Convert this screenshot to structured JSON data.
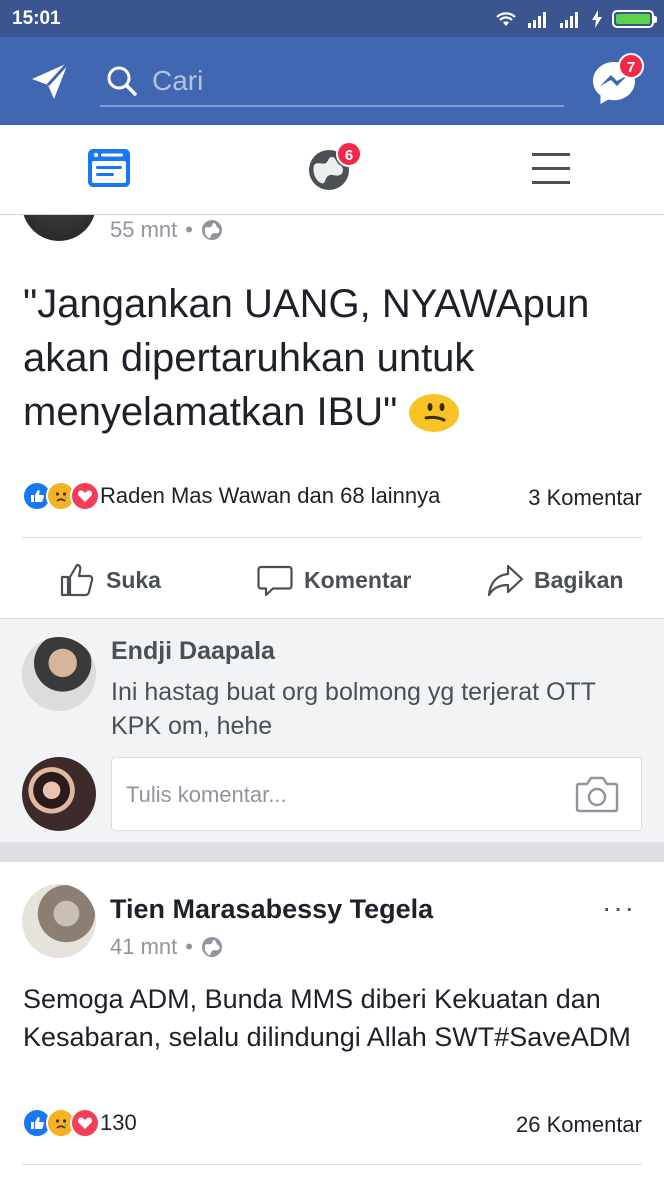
{
  "status_bar": {
    "time": "15:01"
  },
  "header": {
    "search_placeholder": "Cari",
    "messenger_badge": "7"
  },
  "tabs": {
    "notifications_badge": "6"
  },
  "post1": {
    "time": "55 mnt",
    "text": "\"Jangankan UANG, NYAWApun akan dipertaruhkan untuk menyelamatkan IBU\"",
    "reactions_text": "Raden Mas Wawan dan 68 lainnya",
    "comments_count": "3 Komentar",
    "actions": {
      "like": "Suka",
      "comment": "Komentar",
      "share": "Bagikan"
    }
  },
  "comments": {
    "items": [
      {
        "author": "Endji Daapala",
        "text": "Ini hastag buat org bolmong yg terjerat OTT KPK om, hehe"
      }
    ],
    "input_placeholder": "Tulis komentar..."
  },
  "post2": {
    "author": "Tien Marasabessy Tegela",
    "time": "41 mnt",
    "text": "Semoga ADM, Bunda MMS diberi Kekuatan dan Kesabaran, selalu dilindungi Allah SWT#SaveADM",
    "reactions_text": "130",
    "comments_count": "26 Komentar",
    "more": "···"
  },
  "colors": {
    "brand": "#4267b2",
    "status_bar": "#3a5590",
    "badge": "#f02849"
  }
}
